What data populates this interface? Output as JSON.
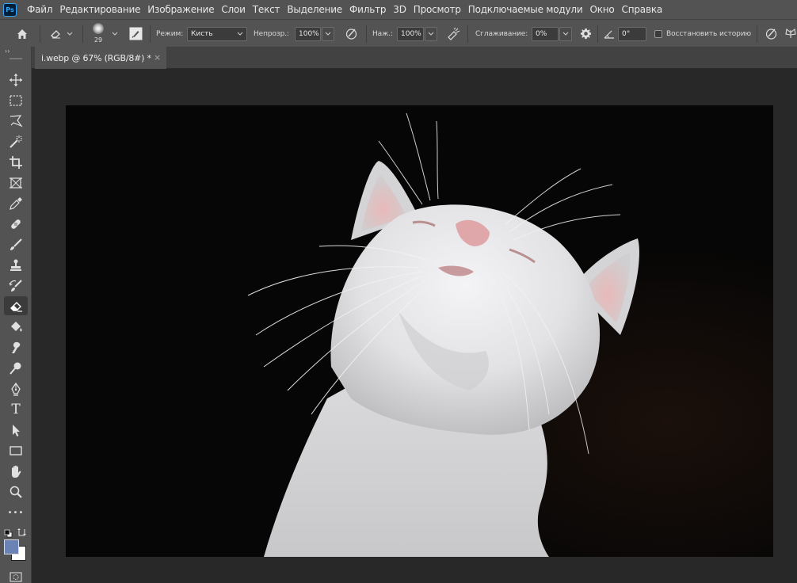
{
  "app": {
    "logo_text": "Ps"
  },
  "menu": [
    "Файл",
    "Редактирование",
    "Изображение",
    "Слои",
    "Текст",
    "Выделение",
    "Фильтр",
    "3D",
    "Просмотр",
    "Подключаемые модули",
    "Окно",
    "Справка"
  ],
  "options": {
    "brush_size": "29",
    "mode_label": "Режим:",
    "mode_value": "Кисть",
    "opacity_label": "Непрозр.:",
    "opacity_value": "100%",
    "pressure_label": "Наж.:",
    "pressure_value": "100%",
    "smoothing_label": "Сглаживание:",
    "smoothing_value": "0%",
    "angle_value": "0°",
    "restore_history_label": "Восстановить историю",
    "restore_history_checked": false
  },
  "document": {
    "tab_title": "i.webp @ 67% (RGB/8#) *",
    "close_glyph": "×"
  },
  "toolbar": {
    "collapse_glyph": "››",
    "active_tool": "eraser-tool",
    "tools": [
      "move-tool",
      "marquee-tool",
      "lasso-tool",
      "magic-wand-tool",
      "crop-tool",
      "frame-tool",
      "eyedropper-tool",
      "healing-brush-tool",
      "brush-tool",
      "clone-stamp-tool",
      "history-brush-tool",
      "eraser-tool",
      "paint-bucket-tool",
      "smudge-tool",
      "dodge-tool",
      "pen-tool",
      "type-tool",
      "path-selection-tool",
      "rectangle-tool",
      "hand-tool",
      "zoom-tool",
      "more-tools"
    ],
    "type_glyph": "T",
    "more_glyph": "•••",
    "foreground_color": "#6b82b5",
    "background_color": "#ffffff"
  },
  "colors": {
    "panel": "#535353",
    "canvas_bg": "#282828",
    "image_bg": "#060606"
  }
}
